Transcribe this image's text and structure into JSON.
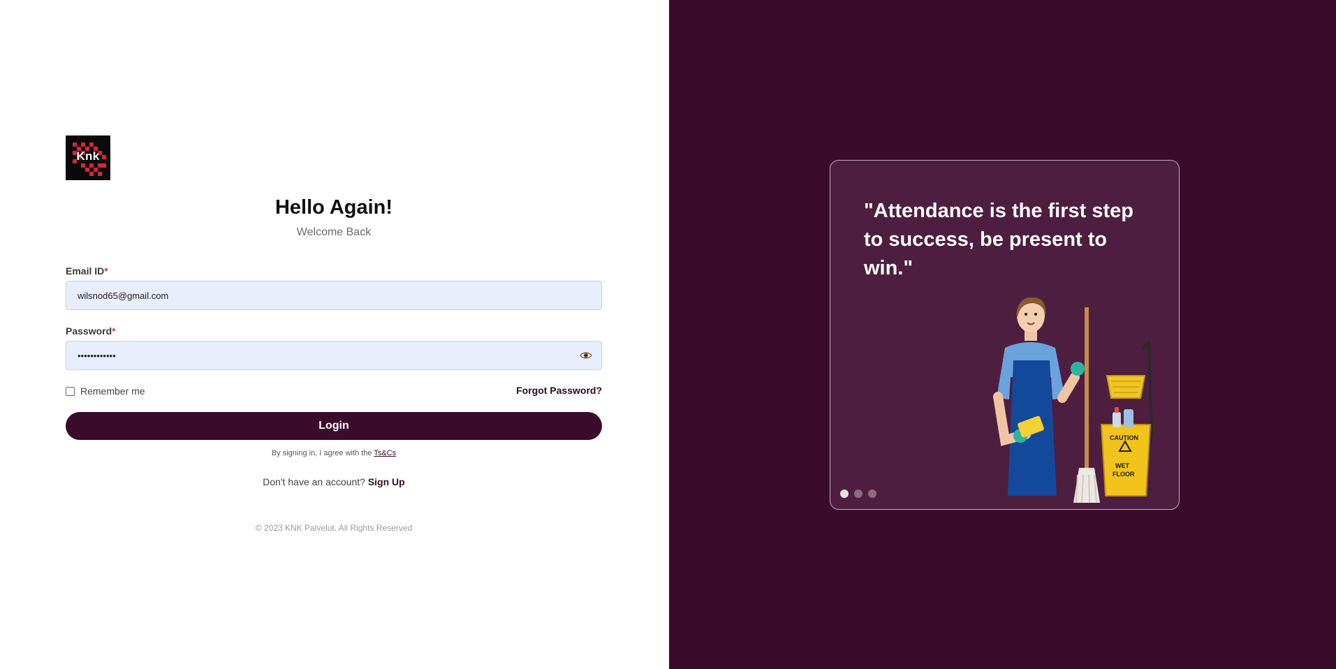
{
  "brand": {
    "logo_text": "Knk",
    "accent_color": "#3a0b2b"
  },
  "login": {
    "title": "Hello Again!",
    "subtitle": "Welcome Back",
    "email_label": "Email ID",
    "email_value": "wilsnod65@gmail.com",
    "password_label": "Password",
    "password_value": "wilsnod65@12",
    "required_mark": "*",
    "show_password_icon": "eye-icon",
    "remember_label": "Remember me",
    "remember_checked": false,
    "forgot_label": "Forgot Password?",
    "login_button": "Login",
    "agree_prefix": "By signing in, I agree with the ",
    "agree_link": "Ts&Cs",
    "signup_prefix": "Don't have an account? ",
    "signup_link": "Sign Up",
    "copyright": "© 2023 KNK Palvelut. All Rights Reserved"
  },
  "carousel": {
    "quote": "\"Attendance is the first step to success, be present to win.\"",
    "illustration": "cleaning-worker-with-mop-bucket",
    "slide_count": 3,
    "active_slide": 1
  }
}
